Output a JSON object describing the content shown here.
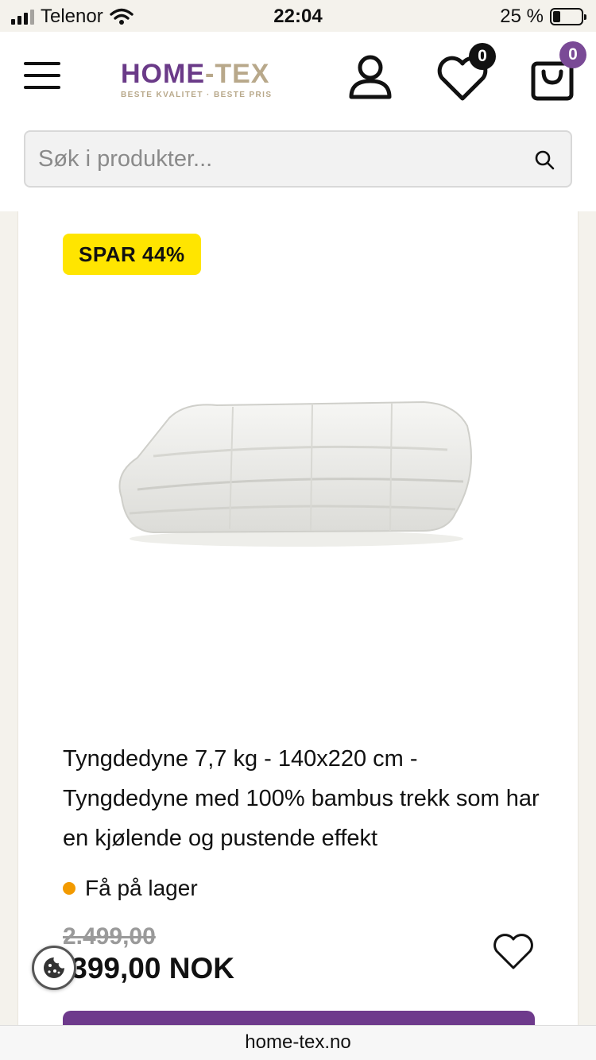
{
  "status_bar": {
    "carrier": "Telenor",
    "time": "22:04",
    "battery": "25 %",
    "battery_level": 0.25
  },
  "header": {
    "brand_a": "HOME",
    "brand_dash": "-",
    "brand_b": "TEX",
    "tagline": "BESTE KVALITET · BESTE PRIS",
    "wishlist_count": "0",
    "cart_count": "0",
    "icons": [
      "menu-icon",
      "user-icon",
      "heart-icon",
      "shopping-bag-icon"
    ]
  },
  "search": {
    "placeholder": "Søk i produkter..."
  },
  "product": {
    "sale_badge": "SPAR 44%",
    "title": "Tyngdedyne 7,7 kg - 140x220 cm - Tyngdedyne med 100% bambus trekk som har en kjølende og pustende effekt",
    "stock": "Få på lager",
    "old_price": "2.499,00",
    "price": ".399,00 NOK"
  },
  "url": "home-tex.no",
  "colors": {
    "brand_purple": "#6e3a8c",
    "brand_beige": "#b8a88a",
    "sale_yellow": "#ffe500",
    "stock_orange": "#f29a00"
  }
}
